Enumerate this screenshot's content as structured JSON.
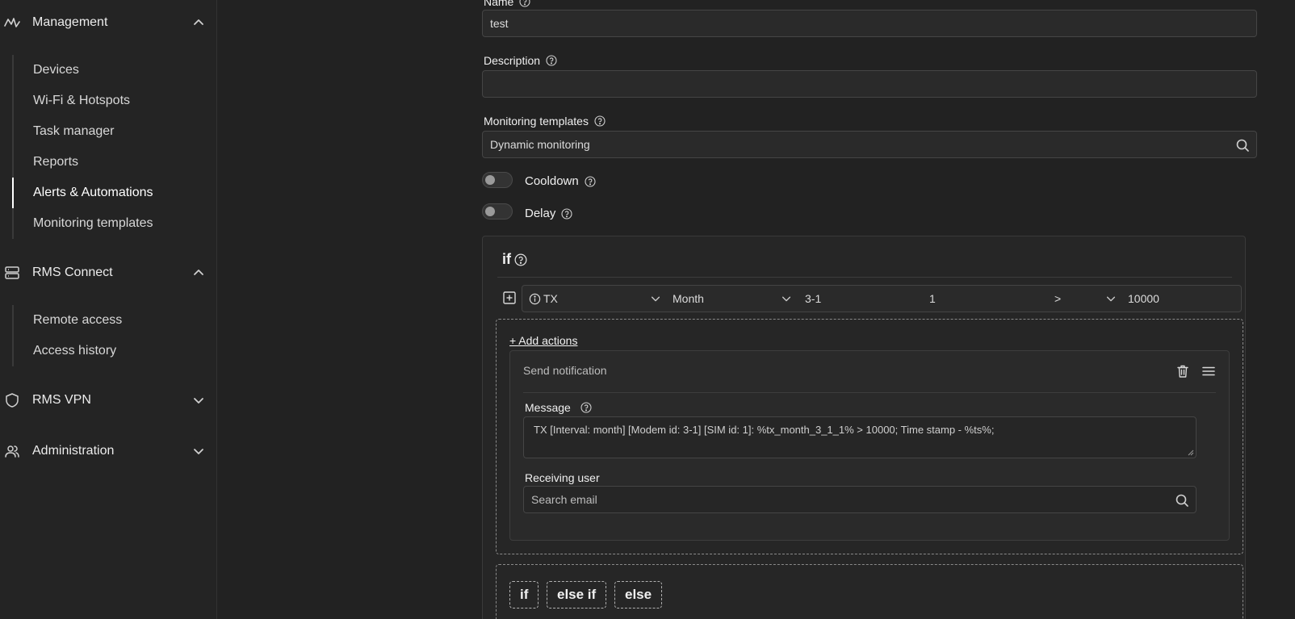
{
  "sidebar": {
    "groups": [
      {
        "label": "Management",
        "icon": "activity-icon",
        "expanded": true,
        "items": [
          {
            "label": "Devices"
          },
          {
            "label": "Wi-Fi & Hotspots"
          },
          {
            "label": "Task manager"
          },
          {
            "label": "Reports"
          },
          {
            "label": "Alerts & Automations",
            "active": true
          },
          {
            "label": "Monitoring templates"
          }
        ]
      },
      {
        "label": "RMS Connect",
        "icon": "server-icon",
        "expanded": true,
        "items": [
          {
            "label": "Remote access"
          },
          {
            "label": "Access history"
          }
        ]
      },
      {
        "label": "RMS VPN",
        "icon": "shield-icon",
        "expanded": false
      },
      {
        "label": "Administration",
        "icon": "users-icon",
        "expanded": false
      }
    ]
  },
  "form": {
    "name_label": "Name",
    "name_value": "test",
    "description_label": "Description",
    "description_value": "",
    "templates_label": "Monitoring templates",
    "templates_value": "Dynamic monitoring",
    "cooldown_label": "Cooldown",
    "delay_label": "Delay"
  },
  "rule": {
    "if_label": "if",
    "condition": {
      "metric": "TX",
      "interval": "Month",
      "modem_id": "3-1",
      "sim_id": "1",
      "operator": ">",
      "threshold": "10000"
    },
    "add_actions_label": "+ Add actions",
    "action": {
      "title": "Send notification",
      "message_label": "Message",
      "message_value": "TX [Interval: month] [Modem id: 3-1] [SIM id: 1]: %tx_month_3_1_1% > 10000; Time stamp - %ts%;",
      "receiving_user_label": "Receiving user",
      "receiving_user_placeholder": "Search email"
    },
    "branch_buttons": {
      "if": "if",
      "else_if": "else if",
      "else": "else"
    }
  },
  "colors": {
    "background": "#222222",
    "sidebar": "#242424",
    "field": "#2a2a2a",
    "border": "#454545",
    "text": "#e6e6e6"
  }
}
